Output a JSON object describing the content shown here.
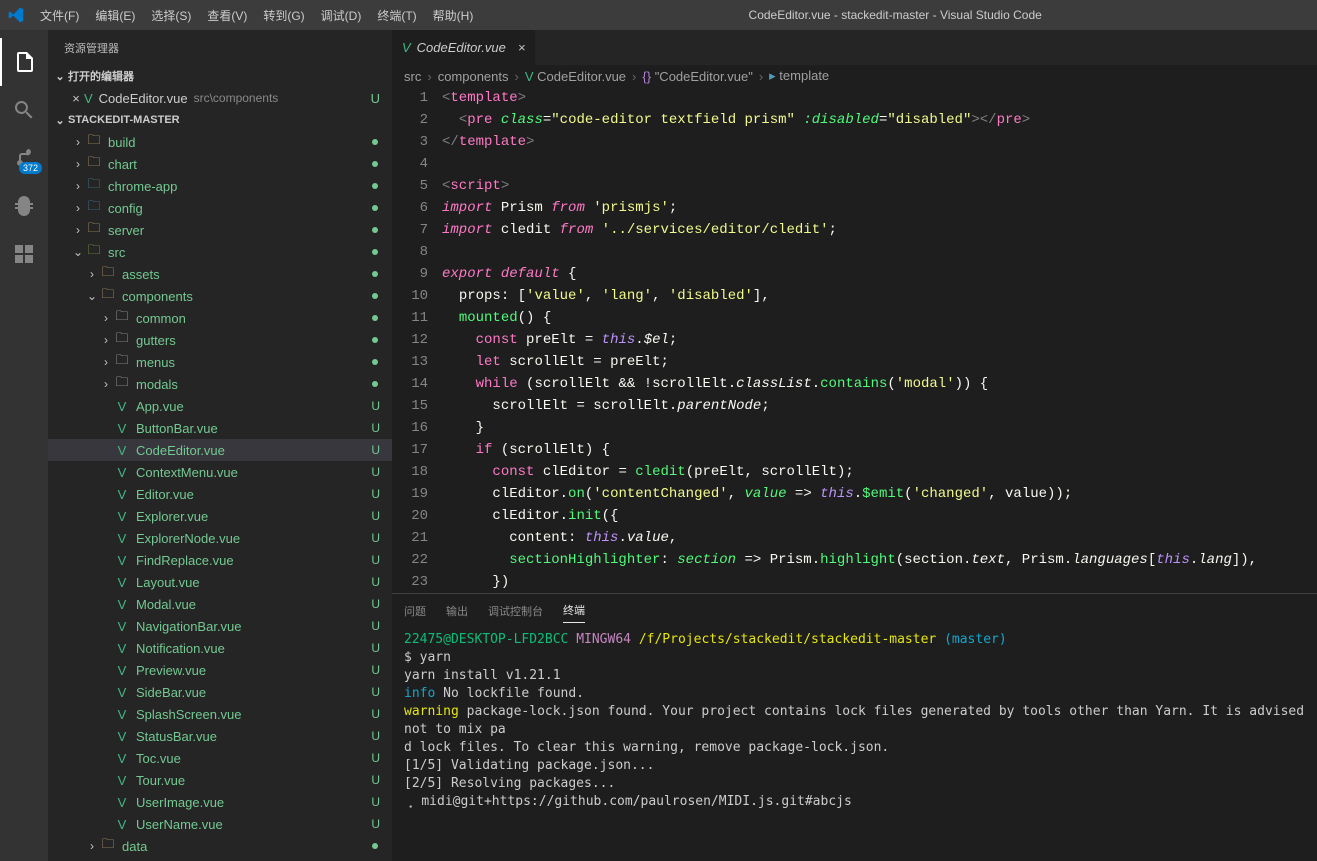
{
  "titlebar": {
    "menus": [
      "文件(F)",
      "编辑(E)",
      "选择(S)",
      "查看(V)",
      "转到(G)",
      "调试(D)",
      "终端(T)",
      "帮助(H)"
    ],
    "title": "CodeEditor.vue - stackedit-master - Visual Studio Code"
  },
  "activitybar": {
    "scm_badge": "372"
  },
  "sidebar": {
    "title": "资源管理器",
    "open_editors_label": "打开的编辑器",
    "open_editor": {
      "name": "CodeEditor.vue",
      "path": "src\\components",
      "status": "U"
    },
    "workspace_label": "STACKEDIT-MASTER",
    "tree": [
      {
        "type": "folder",
        "name": "build",
        "depth": 1,
        "folderColor": "y",
        "dot": true
      },
      {
        "type": "folder",
        "name": "chart",
        "depth": 1,
        "folderColor": "y",
        "dot": true
      },
      {
        "type": "folder",
        "name": "chrome-app",
        "depth": 1,
        "folderColor": "b",
        "dot": true
      },
      {
        "type": "folder",
        "name": "config",
        "depth": 1,
        "folderColor": "b",
        "dot": true
      },
      {
        "type": "folder",
        "name": "server",
        "depth": 1,
        "folderColor": "y",
        "dot": true
      },
      {
        "type": "folder",
        "name": "src",
        "depth": 1,
        "folderColor": "g",
        "open": true,
        "dot": true
      },
      {
        "type": "folder",
        "name": "assets",
        "depth": 2,
        "folderColor": "y",
        "dot": true
      },
      {
        "type": "folder",
        "name": "components",
        "depth": 2,
        "folderColor": "y",
        "open": true,
        "dot": true
      },
      {
        "type": "folder",
        "name": "common",
        "depth": 3,
        "folderColor": "p",
        "dot": true
      },
      {
        "type": "folder",
        "name": "gutters",
        "depth": 3,
        "folderColor": "p",
        "dot": true
      },
      {
        "type": "folder",
        "name": "menus",
        "depth": 3,
        "folderColor": "p",
        "dot": true
      },
      {
        "type": "folder",
        "name": "modals",
        "depth": 3,
        "folderColor": "p",
        "dot": true
      },
      {
        "type": "file",
        "name": "App.vue",
        "depth": 3,
        "status": "U"
      },
      {
        "type": "file",
        "name": "ButtonBar.vue",
        "depth": 3,
        "status": "U"
      },
      {
        "type": "file",
        "name": "CodeEditor.vue",
        "depth": 3,
        "status": "U",
        "selected": true
      },
      {
        "type": "file",
        "name": "ContextMenu.vue",
        "depth": 3,
        "status": "U"
      },
      {
        "type": "file",
        "name": "Editor.vue",
        "depth": 3,
        "status": "U"
      },
      {
        "type": "file",
        "name": "Explorer.vue",
        "depth": 3,
        "status": "U"
      },
      {
        "type": "file",
        "name": "ExplorerNode.vue",
        "depth": 3,
        "status": "U"
      },
      {
        "type": "file",
        "name": "FindReplace.vue",
        "depth": 3,
        "status": "U"
      },
      {
        "type": "file",
        "name": "Layout.vue",
        "depth": 3,
        "status": "U"
      },
      {
        "type": "file",
        "name": "Modal.vue",
        "depth": 3,
        "status": "U"
      },
      {
        "type": "file",
        "name": "NavigationBar.vue",
        "depth": 3,
        "status": "U"
      },
      {
        "type": "file",
        "name": "Notification.vue",
        "depth": 3,
        "status": "U"
      },
      {
        "type": "file",
        "name": "Preview.vue",
        "depth": 3,
        "status": "U"
      },
      {
        "type": "file",
        "name": "SideBar.vue",
        "depth": 3,
        "status": "U"
      },
      {
        "type": "file",
        "name": "SplashScreen.vue",
        "depth": 3,
        "status": "U"
      },
      {
        "type": "file",
        "name": "StatusBar.vue",
        "depth": 3,
        "status": "U"
      },
      {
        "type": "file",
        "name": "Toc.vue",
        "depth": 3,
        "status": "U"
      },
      {
        "type": "file",
        "name": "Tour.vue",
        "depth": 3,
        "status": "U"
      },
      {
        "type": "file",
        "name": "UserImage.vue",
        "depth": 3,
        "status": "U"
      },
      {
        "type": "file",
        "name": "UserName.vue",
        "depth": 3,
        "status": "U"
      },
      {
        "type": "folder",
        "name": "data",
        "depth": 2,
        "folderColor": "y",
        "dot": true
      }
    ]
  },
  "editor": {
    "tab": {
      "name": "CodeEditor.vue"
    },
    "breadcrumb": [
      "src",
      "components",
      "CodeEditor.vue",
      "\"CodeEditor.vue\"",
      "template"
    ],
    "line_start": 1,
    "line_end": 23
  },
  "panel": {
    "tabs": [
      "问题",
      "输出",
      "调试控制台",
      "终端"
    ],
    "active_tab": 3,
    "terminal": {
      "user": "22475@DESKTOP-LFD2BCC",
      "sys": "MINGW64",
      "path": "/f/Projects/stackedit/stackedit-master",
      "branch": "(master)",
      "lines": [
        "$ yarn",
        "yarn install v1.21.1",
        {
          "prefix": "info",
          "text": " No lockfile found."
        },
        {
          "prefix": "warning",
          "text": " package-lock.json found. Your project contains lock files generated by tools other than Yarn. It is advised not to mix pa"
        },
        "d lock files. To clear this warning, remove package-lock.json.",
        "[1/5] Validating package.json...",
        "[2/5] Resolving packages...",
        "⢀ midi@git+https://github.com/paulrosen/MIDI.js.git#abcjs"
      ]
    }
  }
}
